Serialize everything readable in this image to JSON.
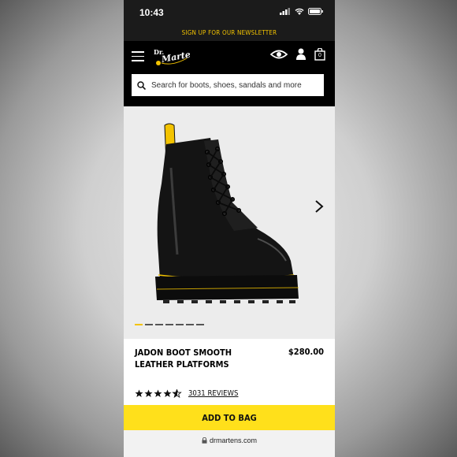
{
  "status": {
    "time": "10:43"
  },
  "newsletter": {
    "text": "SIGN UP FOR OUR NEWSLETTER"
  },
  "header": {
    "logo_text": "Dr. Martens",
    "cart_count": "0",
    "icons": [
      "menu-icon",
      "eye-icon",
      "account-icon",
      "bag-icon"
    ]
  },
  "search": {
    "placeholder": "Search for boots, shoes, sandals and more"
  },
  "gallery": {
    "slide_count": 7,
    "active_index": 0
  },
  "product": {
    "name": "JADON BOOT SMOOTH LEATHER PLATFORMS",
    "price": "$280.00",
    "rating": 4.5,
    "reviews": "3031 REVIEWS"
  },
  "cta": {
    "add_to_bag": "ADD TO BAG"
  },
  "browser": {
    "url": "drmartens.com"
  },
  "colors": {
    "brand_yellow": "#ffe01b",
    "header_bg": "#000000",
    "newsletter_text": "#f3c300"
  }
}
